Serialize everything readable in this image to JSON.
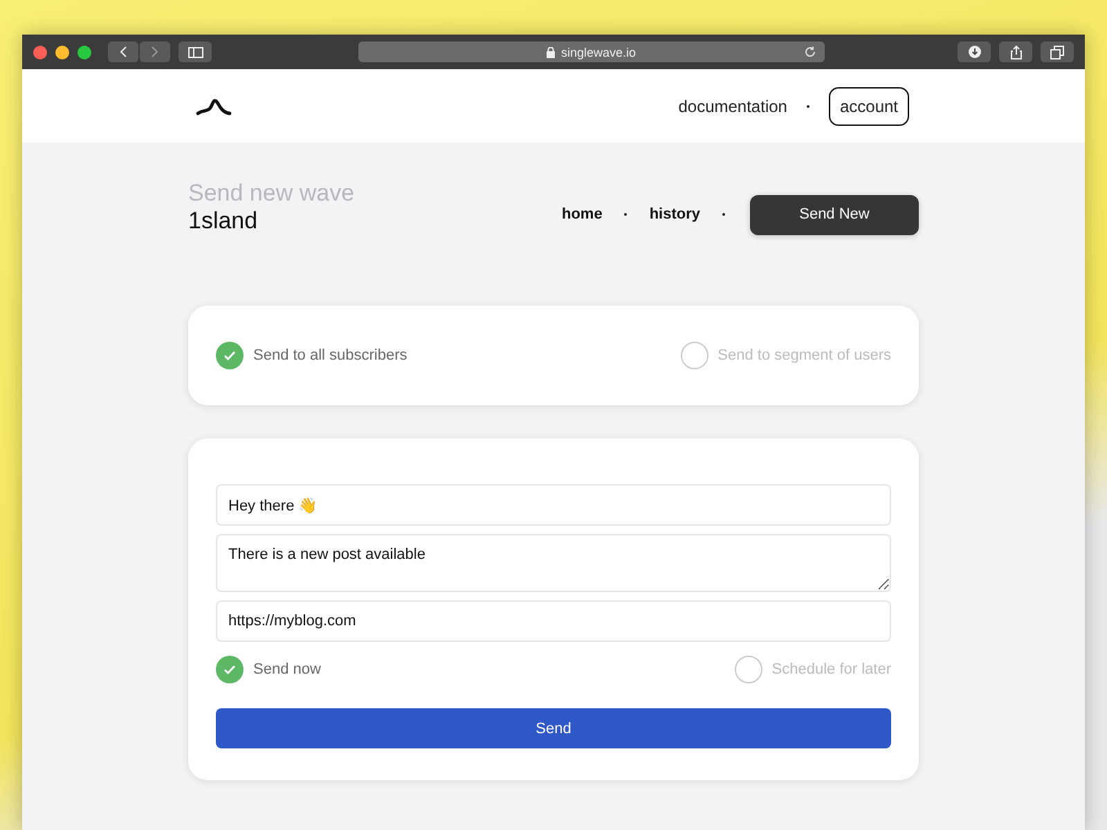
{
  "browser": {
    "address": "singlewave.io"
  },
  "header": {
    "nav": [
      {
        "label": "documentation",
        "kind": "link"
      },
      {
        "label": "account",
        "kind": "outlined"
      }
    ]
  },
  "page": {
    "title": "Send new wave",
    "subtitle": "1sland",
    "nav": [
      {
        "label": "home"
      },
      {
        "label": "history"
      }
    ],
    "primary_button": "Send New"
  },
  "audience": [
    {
      "label": "Send to all subscribers",
      "selected": true
    },
    {
      "label": "Send to segment of users",
      "selected": false
    }
  ],
  "form": {
    "fields": [
      {
        "kind": "input",
        "value": "Hey there 👋"
      },
      {
        "kind": "textarea",
        "value": "There is a new post available"
      },
      {
        "kind": "input",
        "value": "https://myblog.com"
      }
    ],
    "timing": [
      {
        "label": "Send now",
        "selected": true
      },
      {
        "label": "Schedule for later",
        "selected": false
      }
    ],
    "submit": "Send"
  }
}
